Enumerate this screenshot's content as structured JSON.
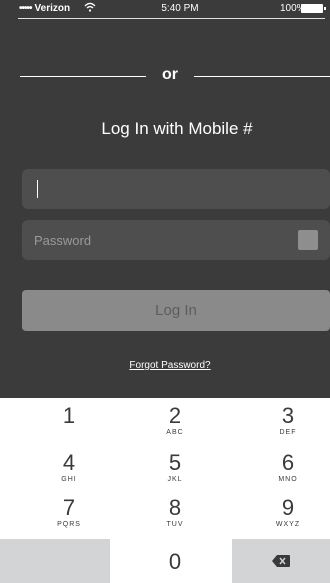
{
  "status_bar": {
    "dots": "•••••",
    "carrier": "Verizon",
    "time": "5:40 PM",
    "battery": "100%"
  },
  "divider": {
    "text": "or"
  },
  "title": "Log In with Mobile #",
  "form": {
    "phone_value": "",
    "password_placeholder": "Password",
    "login_label": "Log In",
    "forgot_label": "Forgot Password?"
  },
  "keypad": {
    "keys": [
      {
        "num": "1",
        "letters": ""
      },
      {
        "num": "2",
        "letters": "ABC"
      },
      {
        "num": "3",
        "letters": "DEF"
      },
      {
        "num": "4",
        "letters": "GHI"
      },
      {
        "num": "5",
        "letters": "JKL"
      },
      {
        "num": "6",
        "letters": "MNO"
      },
      {
        "num": "7",
        "letters": "PQRS"
      },
      {
        "num": "8",
        "letters": "TUV"
      },
      {
        "num": "9",
        "letters": "WXYZ"
      },
      {
        "num": "0",
        "letters": ""
      }
    ],
    "delete_icon": "backspace-icon"
  }
}
